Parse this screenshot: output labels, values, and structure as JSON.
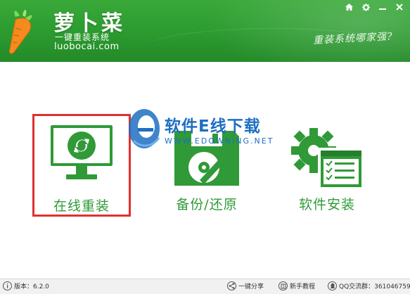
{
  "app": {
    "name": "萝卜菜",
    "subtitle": "一键重装系统",
    "domain": "luobocai.com",
    "slogan": "重装系统哪家强?"
  },
  "window_controls": {
    "icons": [
      "home-icon",
      "settings-icon",
      "minimize-icon",
      "close-icon"
    ]
  },
  "features": [
    {
      "label": "在线重装",
      "icon": "monitor-refresh-icon",
      "selected": true
    },
    {
      "label": "备份/还原",
      "icon": "disk-icon",
      "selected": false
    },
    {
      "label": "软件安装",
      "icon": "gear-window-icon",
      "selected": false
    }
  ],
  "watermark": {
    "title": "软件E线下载",
    "url": "WWW.EDOWNING.NET"
  },
  "footer": {
    "version": "版本：6.2.0",
    "share": "一键分享",
    "tutorial": "新手教程",
    "qq_group": "QQ交流群：361046759"
  },
  "colors": {
    "header_green": "#2b9a2f",
    "feature_green": "#2f9a37",
    "selection_red": "#e03030",
    "watermark_blue": "#1e6fc2"
  }
}
